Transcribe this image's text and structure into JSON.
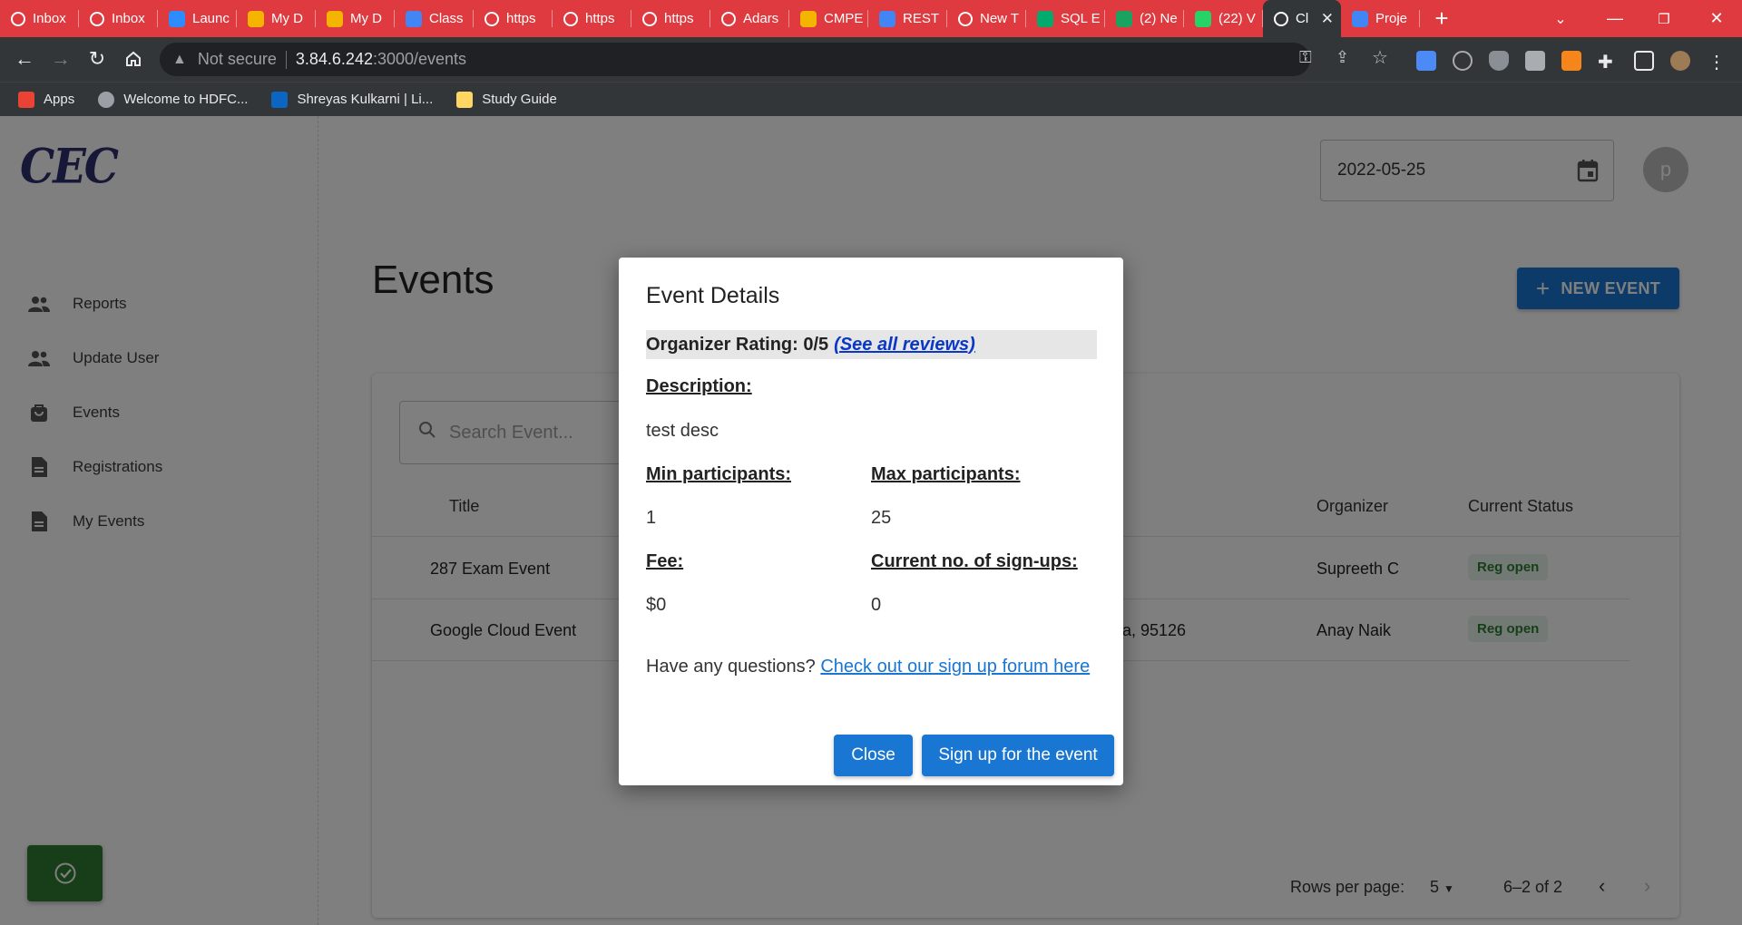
{
  "browser": {
    "tabs": [
      {
        "label": "Inbox",
        "icon": "gmail-icon",
        "color": "#ffffff"
      },
      {
        "label": "Inbox",
        "icon": "gmail-icon",
        "color": "#ffffff"
      },
      {
        "label": "Launc",
        "icon": "zoom-icon",
        "color": "#2d8cff"
      },
      {
        "label": "My D",
        "icon": "drive-icon",
        "color": "#f4b400"
      },
      {
        "label": "My D",
        "icon": "drive-icon",
        "color": "#f4b400"
      },
      {
        "label": "Class",
        "icon": "docs-icon",
        "color": "#4285f4"
      },
      {
        "label": "https",
        "icon": "globe-icon",
        "color": "#ffffff"
      },
      {
        "label": "https",
        "icon": "globe-icon",
        "color": "#ffffff"
      },
      {
        "label": "https",
        "icon": "globe-icon",
        "color": "#ffffff"
      },
      {
        "label": "Adars",
        "icon": "github-icon",
        "color": "#ffffff"
      },
      {
        "label": "CMPE",
        "icon": "drive-icon",
        "color": "#f4b400"
      },
      {
        "label": "REST",
        "icon": "docs-icon",
        "color": "#4285f4"
      },
      {
        "label": "New T",
        "icon": "chrome-icon",
        "color": "#ffffff"
      },
      {
        "label": "SQL E",
        "icon": "w3schools-icon",
        "color": "#04aa6d"
      },
      {
        "label": "(2) Ne",
        "icon": "email-icon",
        "color": "#1aa260"
      },
      {
        "label": "(22) V",
        "icon": "whatsapp-icon",
        "color": "#25d366"
      },
      {
        "label": "Cl",
        "icon": "globe-icon",
        "color": "#ffffff",
        "active": true
      },
      {
        "label": "Proje",
        "icon": "docs-icon",
        "color": "#4285f4"
      }
    ],
    "url_not_secure": "Not secure",
    "url_host": "3.84.6.242",
    "url_path": ":3000/events",
    "bookmarks": [
      {
        "label": "Apps",
        "icon": "apps-grid-icon"
      },
      {
        "label": "Welcome to HDFC...",
        "icon": "globe-icon"
      },
      {
        "label": "Shreyas Kulkarni | Li...",
        "icon": "linkedin-icon"
      },
      {
        "label": "Study Guide",
        "icon": "folder-icon"
      }
    ]
  },
  "app": {
    "logo": "CEC",
    "nav": [
      {
        "label": "Reports",
        "icon": "people-icon"
      },
      {
        "label": "Update User",
        "icon": "people-icon"
      },
      {
        "label": "Events",
        "icon": "bag-icon"
      },
      {
        "label": "Registrations",
        "icon": "document-icon"
      },
      {
        "label": "My Events",
        "icon": "document-icon"
      }
    ],
    "date_value": "2022-05-25",
    "avatar_letter": "p",
    "page_title": "Events",
    "new_event_label": "NEW EVENT",
    "search_placeholder": "Search Event...",
    "columns": {
      "title": "Title",
      "organizer": "Organizer",
      "status": "Current Status"
    },
    "rows": [
      {
        "title": "287 Exam Event",
        "address": "",
        "organizer": "Supreeth C",
        "status": "Reg open"
      },
      {
        "title": "Google Cloud Event",
        "address": "ca, 95126",
        "organizer": "Anay Naik",
        "status": "Reg open"
      }
    ],
    "pagination": {
      "rows_per_page_label": "Rows per page:",
      "rows_per_page": "5",
      "range": "6–2 of 2"
    }
  },
  "modal": {
    "title": "Event Details",
    "rating_label": "Organizer Rating: 0/5",
    "reviews_link": "(See all reviews)",
    "description_label": "Description:",
    "description": "test desc",
    "min_label": "Min participants:",
    "min_value": "1",
    "max_label": "Max participants:",
    "max_value": "25",
    "fee_label": "Fee:",
    "fee_value": "$0",
    "signups_label": "Current no. of sign-ups:",
    "signups_value": "0",
    "help_text": "Have any questions?",
    "help_link": "Check out our sign up forum here",
    "close_label": "Close",
    "signup_label": "Sign up for the event"
  }
}
